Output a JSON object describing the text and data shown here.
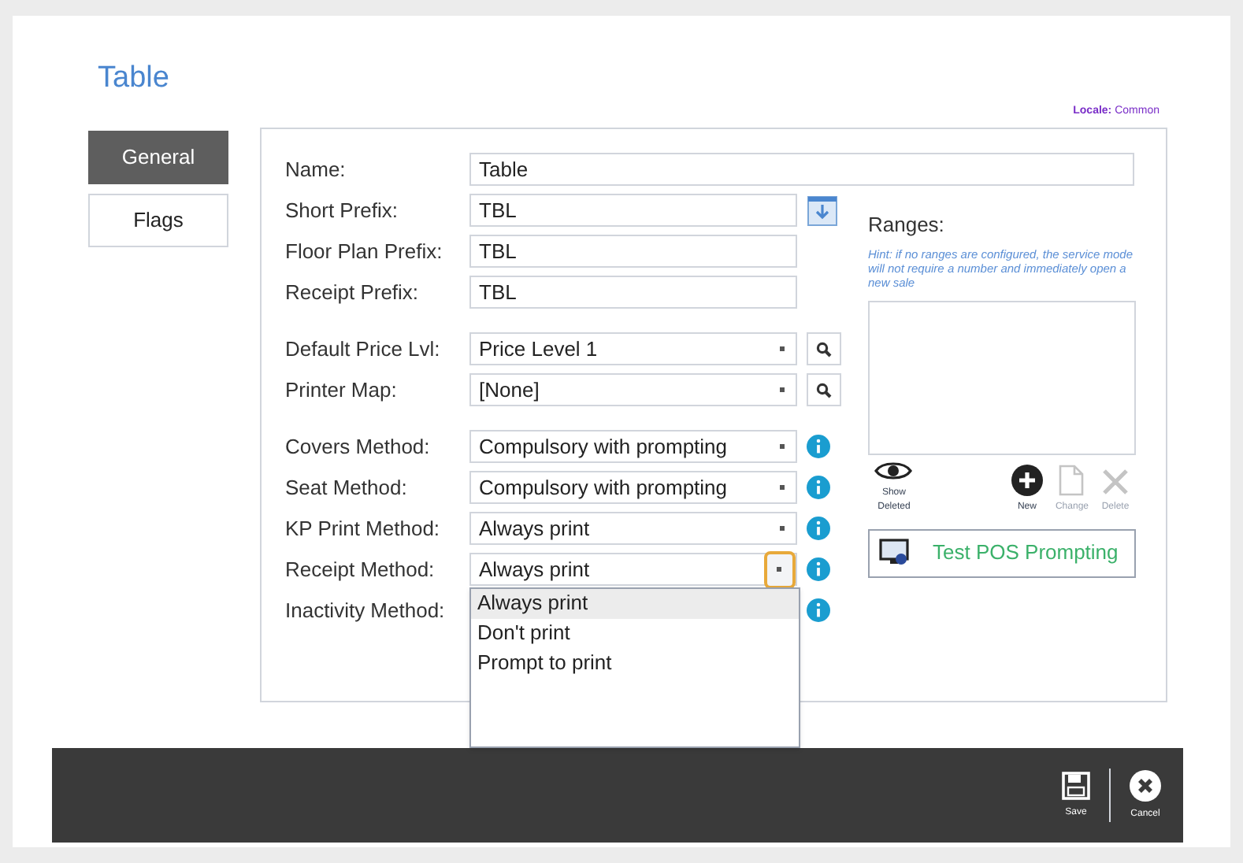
{
  "title": "Table",
  "locale": {
    "label": "Locale:",
    "value": "Common"
  },
  "tabs": [
    {
      "label": "General",
      "selected": true
    },
    {
      "label": "Flags",
      "selected": false
    }
  ],
  "field_groups": [
    [
      {
        "label": "Name:",
        "value": "Table",
        "kind": "wide"
      },
      {
        "label": "Short Prefix:",
        "value": "TBL",
        "kind": "text-import"
      },
      {
        "label": "Floor Plan Prefix:",
        "value": "TBL",
        "kind": "text"
      },
      {
        "label": "Receipt Prefix:",
        "value": "TBL",
        "kind": "text"
      }
    ],
    [
      {
        "label": "Default Price Lvl:",
        "value": "Price Level 1",
        "kind": "select-search"
      },
      {
        "label": "Printer Map:",
        "value": "[None]",
        "kind": "select-search"
      }
    ],
    [
      {
        "label": "Covers Method:",
        "value": "Compulsory with prompting",
        "kind": "select-info"
      },
      {
        "label": "Seat Method:",
        "value": "Compulsory with prompting",
        "kind": "select-info"
      },
      {
        "label": "KP Print Method:",
        "value": "Always print",
        "kind": "select-info"
      },
      {
        "label": "Receipt Method:",
        "value": "Always print",
        "kind": "select-info",
        "open": true,
        "options": [
          {
            "label": "Always print",
            "selected": true
          },
          {
            "label": "Don't print",
            "selected": false
          },
          {
            "label": "Prompt to print",
            "selected": false
          }
        ]
      },
      {
        "label": "Inactivity Method:",
        "kind": "select-info"
      }
    ]
  ],
  "ranges": {
    "title": "Ranges:",
    "hint": "Hint: if no ranges are configured, the service mode will not require a number and immediately open a new sale",
    "actions": [
      {
        "label": "Show Deleted",
        "kind": "eye",
        "disabled": false
      },
      {
        "label": "New",
        "kind": "plus",
        "disabled": false
      },
      {
        "label": "Change",
        "kind": "page",
        "disabled": true
      },
      {
        "label": "Delete",
        "kind": "x",
        "disabled": true
      }
    ],
    "test_button": "Test POS Prompting"
  },
  "footer": [
    {
      "label": "Save",
      "kind": "save"
    },
    {
      "label": "Cancel",
      "kind": "cancel"
    }
  ]
}
